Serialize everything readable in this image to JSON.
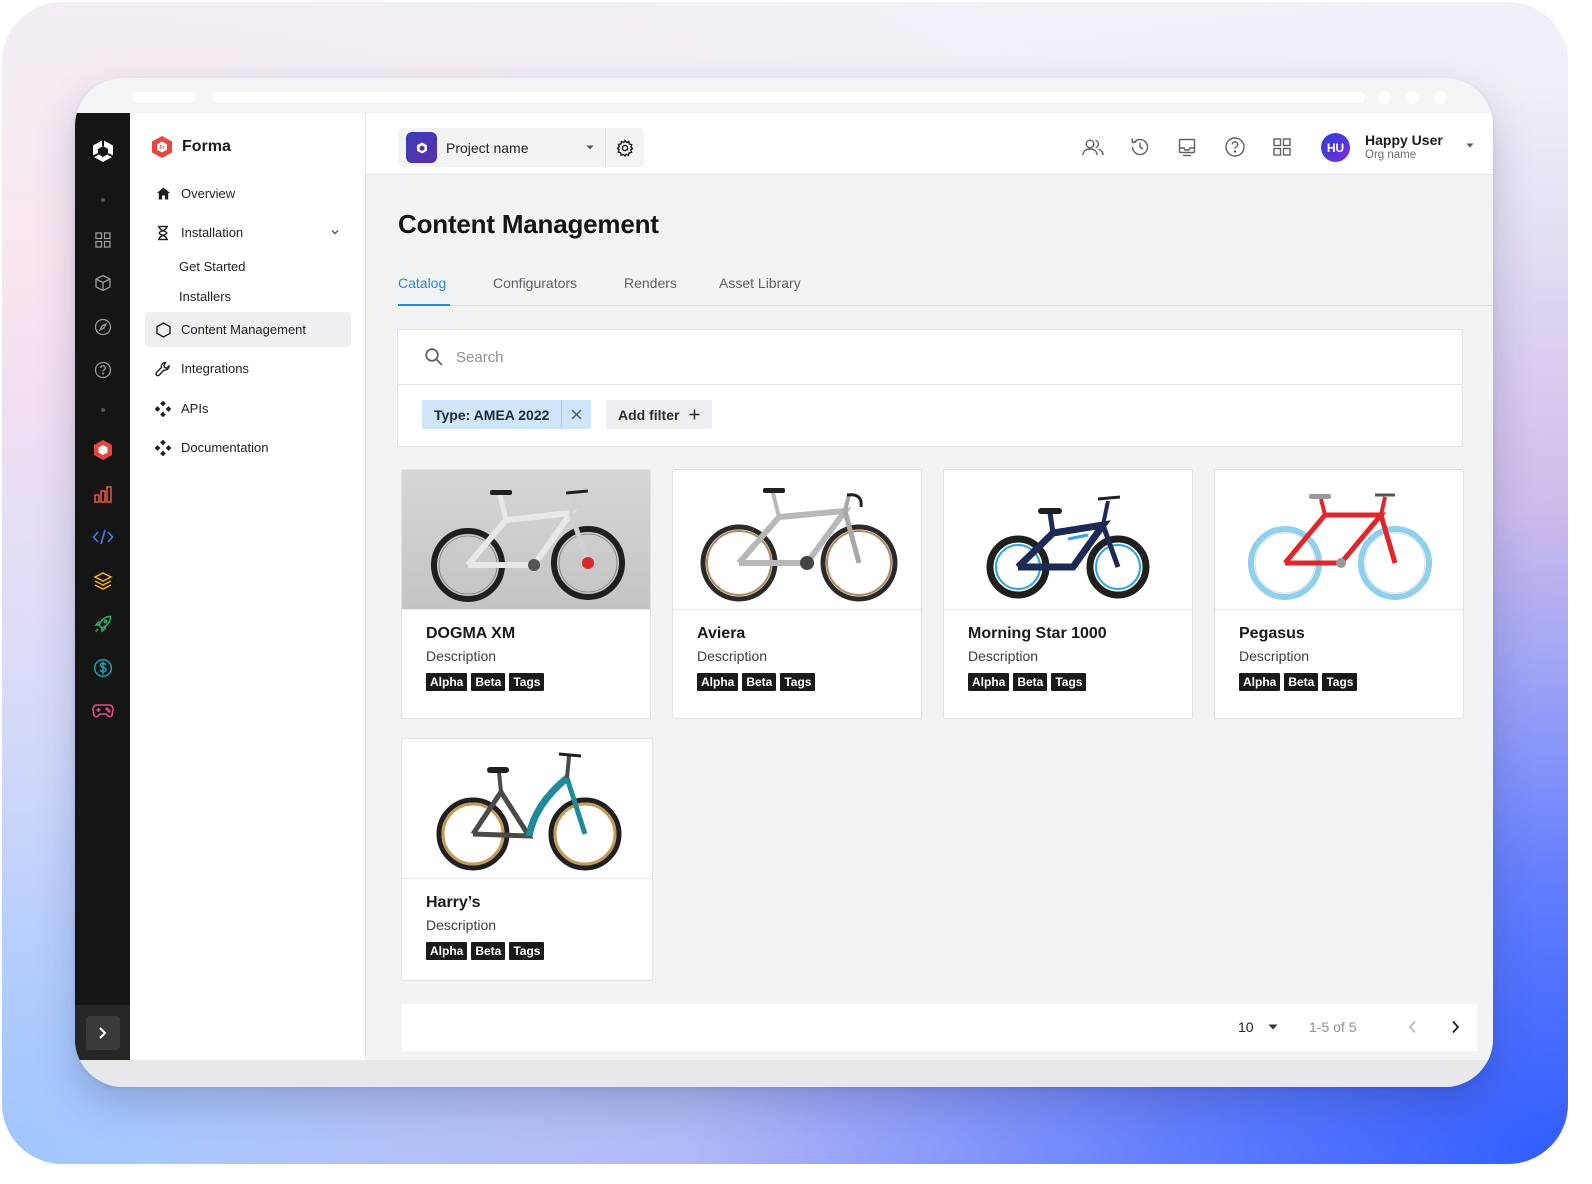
{
  "app": {
    "name": "Forma"
  },
  "sidebar": {
    "items": [
      {
        "label": "Overview",
        "icon": "home-icon"
      },
      {
        "label": "Installation",
        "icon": "hourglass-icon",
        "expanded": true,
        "children": [
          {
            "label": "Get Started"
          },
          {
            "label": "Installers"
          }
        ]
      },
      {
        "label": "Content Management",
        "icon": "hexagon-icon",
        "active": true
      },
      {
        "label": "Integrations",
        "icon": "wrench-icon"
      },
      {
        "label": "APIs",
        "icon": "diamond-nodes-icon"
      },
      {
        "label": "Documentation",
        "icon": "diamond-nodes-icon"
      }
    ]
  },
  "rail": {
    "icons": [
      "unity-logo-icon",
      "dashboard-icon",
      "cube-icon",
      "compass-icon",
      "help-icon",
      "forma-icon",
      "analytics-icon",
      "code-icon",
      "layers-icon",
      "rocket-icon",
      "dollar-icon",
      "gamepad-icon"
    ],
    "colors": {
      "forma": "#e8453c",
      "analytics": "#e8583c",
      "code": "#3b7bf2",
      "layers": "#f2b705",
      "rocket": "#2fb36b",
      "dollar": "#19a2b8",
      "gamepad": "#e0508f"
    }
  },
  "topbar": {
    "project_name": "Project name",
    "icons": [
      "users-icon",
      "history-icon",
      "inbox-icon",
      "help-icon",
      "apps-grid-icon"
    ],
    "user": {
      "initials": "HU",
      "name": "Happy User",
      "org": "Org name"
    }
  },
  "page": {
    "title": "Content Management",
    "tabs": [
      {
        "label": "Catalog",
        "active": true
      },
      {
        "label": "Configurators"
      },
      {
        "label": "Renders"
      },
      {
        "label": "Asset Library"
      }
    ]
  },
  "search": {
    "placeholder": "Search",
    "value": ""
  },
  "filters": {
    "active": [
      {
        "label": "Type: AMEA 2022"
      }
    ],
    "add_label": "Add filter"
  },
  "cards": [
    {
      "title": "DOGMA XM",
      "description": "Description",
      "tags": [
        "Alpha",
        "Beta",
        "Tags"
      ],
      "image": "white-mountain-bike"
    },
    {
      "title": "Aviera",
      "description": "Description",
      "tags": [
        "Alpha",
        "Beta",
        "Tags"
      ],
      "image": "silver-road-bike"
    },
    {
      "title": "Morning Star 1000",
      "description": "Description",
      "tags": [
        "Alpha",
        "Beta",
        "Tags"
      ],
      "image": "kids-bike"
    },
    {
      "title": "Pegasus",
      "description": "Description",
      "tags": [
        "Alpha",
        "Beta",
        "Tags"
      ],
      "image": "red-fixie-bike"
    },
    {
      "title": "Harry’s",
      "description": "Description",
      "tags": [
        "Alpha",
        "Beta",
        "Tags"
      ],
      "image": "teal-step-through-bike"
    }
  ],
  "pagination": {
    "page_size": "10",
    "range": "1-5 of 5"
  },
  "colors": {
    "accent": "#2a86d4",
    "chip_bg": "#cfe5f9",
    "rail_bg": "#151515"
  }
}
